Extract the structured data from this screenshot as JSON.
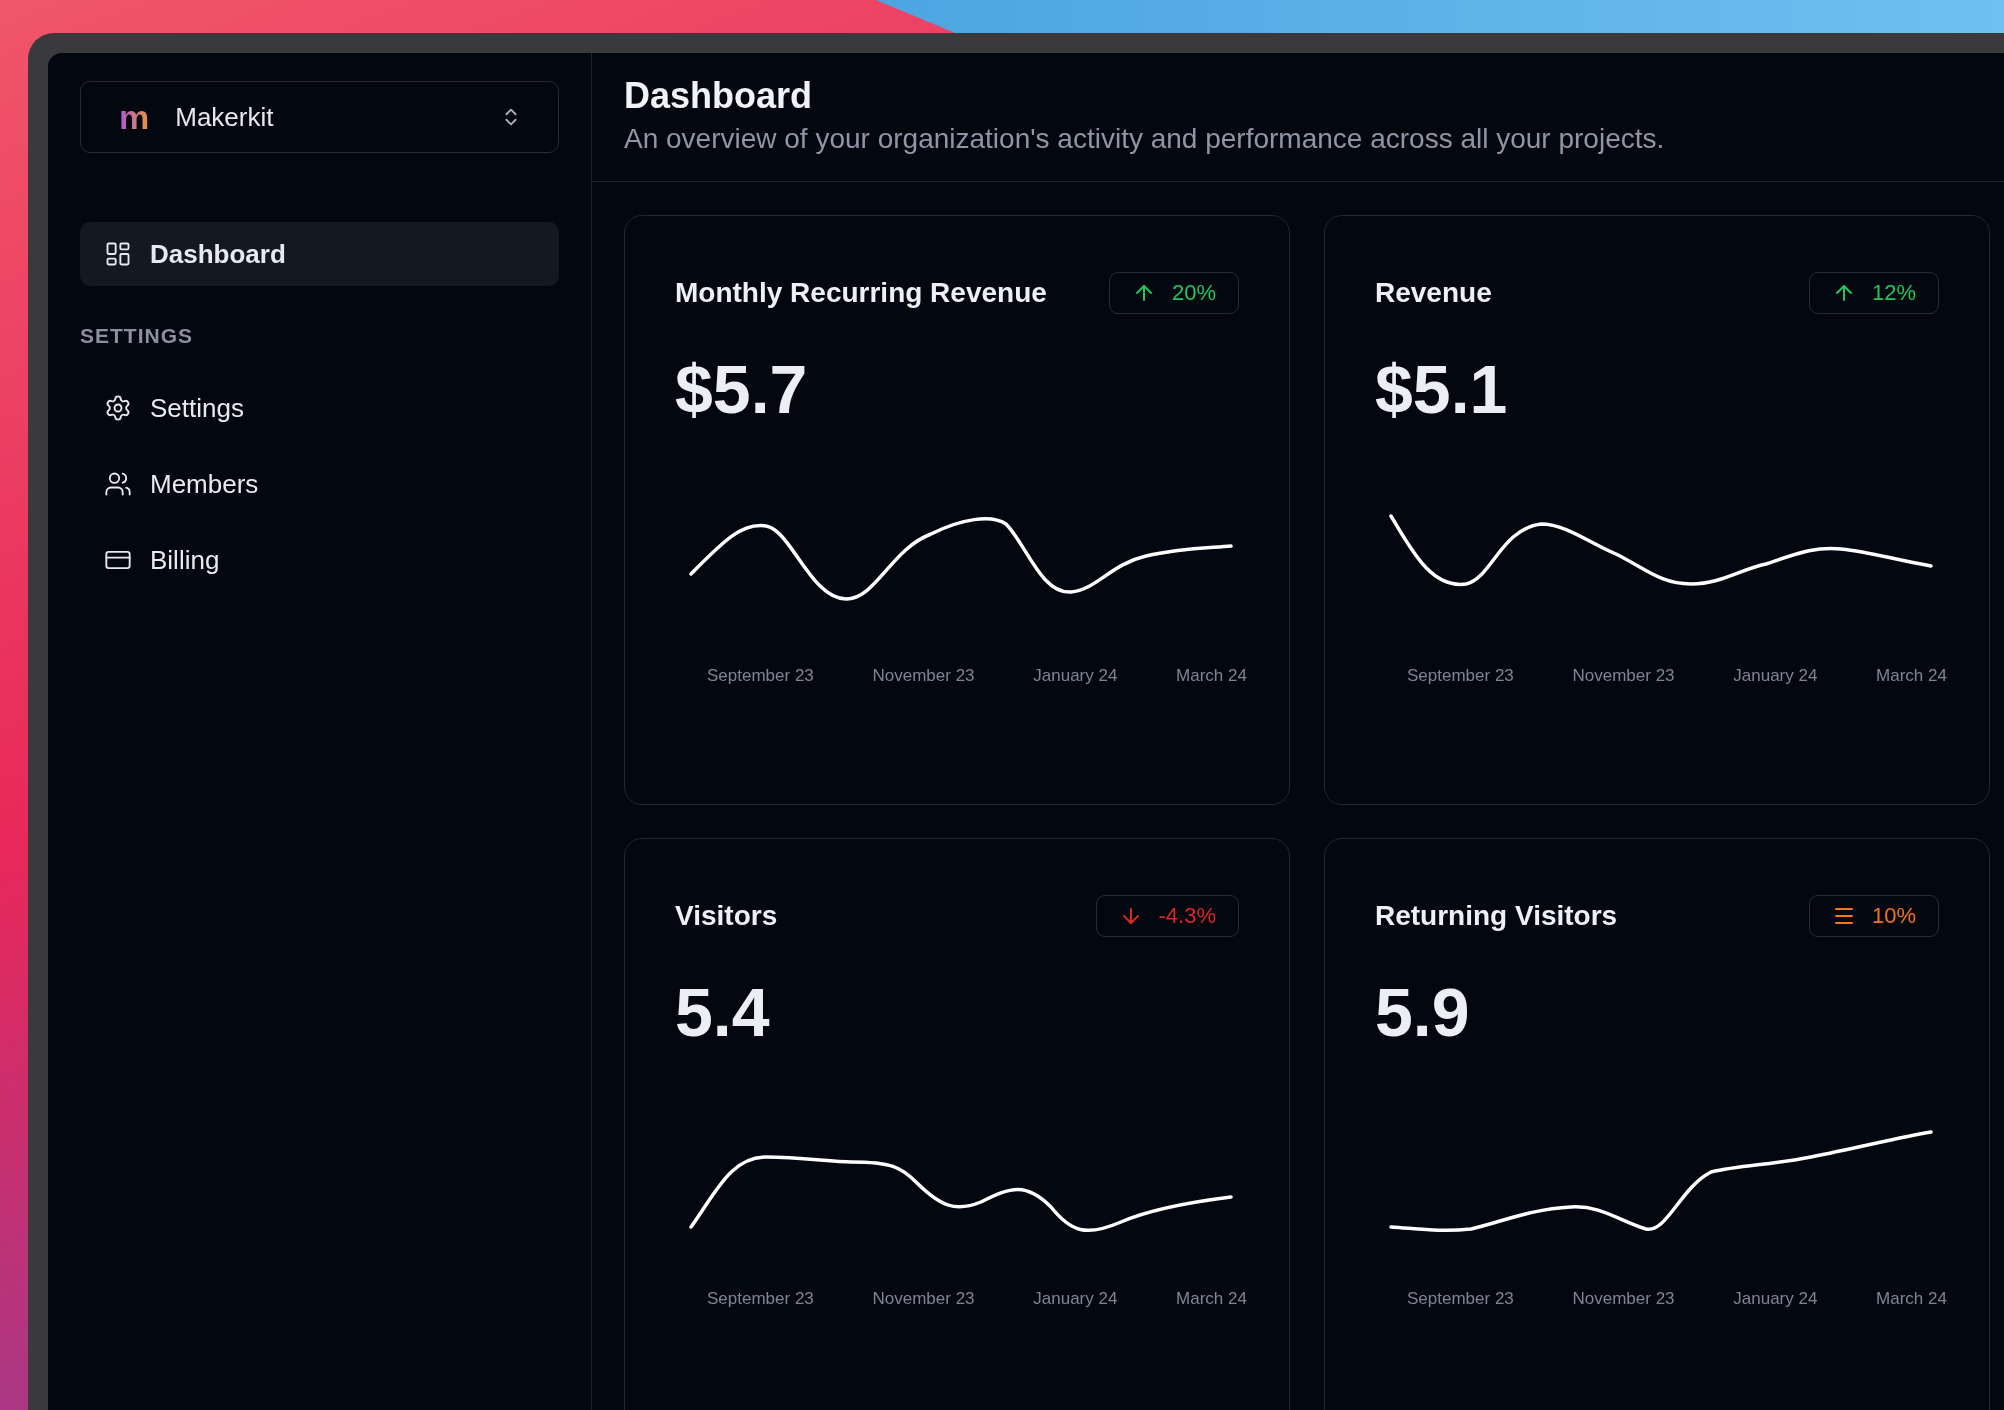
{
  "org": {
    "logo": "m",
    "name": "Makerkit"
  },
  "nav": [
    {
      "label": "Dashboard",
      "kind": "dashboard",
      "selected": true
    }
  ],
  "sections": [
    {
      "heading": "SETTINGS",
      "items": [
        {
          "label": "Settings",
          "kind": "settings",
          "selected": false
        },
        {
          "label": "Members",
          "kind": "members",
          "selected": false
        },
        {
          "label": "Billing",
          "kind": "billing",
          "selected": false
        }
      ]
    }
  ],
  "header": {
    "title": "Dashboard",
    "subtitle": "An overview of your organization's activity and performance across all your projects."
  },
  "cards": [
    {
      "title": "Monthly Recurring Revenue",
      "value": "$5.7",
      "change": "20%",
      "kind": "up",
      "x_labels": [
        "September 23",
        "November 23",
        "January 24",
        "March 24"
      ]
    },
    {
      "title": "Revenue",
      "value": "$5.1",
      "change": "12%",
      "kind": "up",
      "x_labels": [
        "September 23",
        "November 23",
        "January 24",
        "March 24"
      ]
    },
    {
      "title": "Visitors",
      "value": "5.4",
      "change": "-4.3%",
      "kind": "down",
      "x_labels": [
        "September 23",
        "November 23",
        "January 24",
        "March 24"
      ]
    },
    {
      "title": "Returning Visitors",
      "value": "5.9",
      "change": "10%",
      "kind": "flat",
      "x_labels": [
        "September 23",
        "November 23",
        "January 24",
        "March 24"
      ]
    }
  ]
}
